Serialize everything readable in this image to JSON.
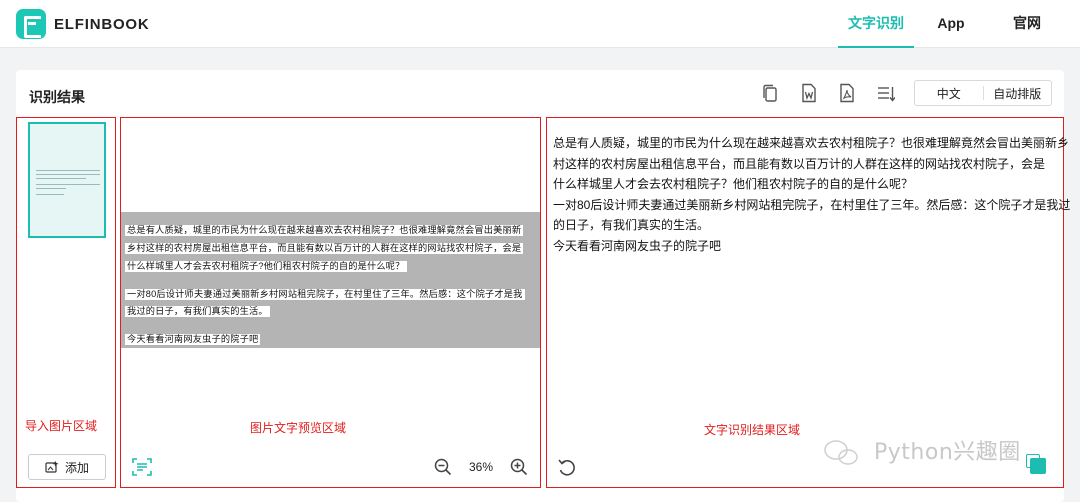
{
  "app": {
    "brand": "ELFINBOOK"
  },
  "nav": {
    "items": [
      "文字识别",
      "App",
      "官网"
    ],
    "active": "文字识别"
  },
  "card": {
    "title": "识别结果"
  },
  "toolbar": {
    "icons": [
      "copy-icon",
      "word-export-icon",
      "pdf-export-icon",
      "sort-lines-icon"
    ],
    "lang": {
      "zh": "中文",
      "auto": "自动排版"
    }
  },
  "captions": {
    "left": "导入图片区域",
    "mid": "图片文字预览区域",
    "right": "文字识别结果区域"
  },
  "left": {
    "add_label": "添加"
  },
  "preview": {
    "lines": [
      "总是有人质疑，城里的市民为什么现在越来越喜欢去农村租院子？也很难理解竟然会冒出美丽新",
      "乡村这样的农村房屋出租信息平台，而且能有数以百万计的人群在这样的网站找农村院子，会是",
      "什么样城里人才会去农村租院子?他们租农村院子的自的是什么呢？",
      "一对80后设计师夫妻通过美丽新乡村网站租完院子，在村里住了三年。然后感：这个院子才是我",
      "我过的日子，有我们真实的生活。",
      "今天看看河南网友虫子的院子吧"
    ],
    "zoom": "36%"
  },
  "result": {
    "lines": [
      "总是有人质疑，城里的市民为什么现在越来越喜欢去农村租院子？也很难理解竟然会冒出美丽新乡",
      "村这样的农村房屋出租信息平台，而且能有数以百万计的人群在这样的网站找农村院子，会是",
      "什么样城里人才会去农村租院子？他们租农村院子的自的是什么呢？",
      "一对80后设计师夫妻通过美丽新乡村网站租完院子，在村里住了三年。然后感：这个院子才是我过",
      "的日子，有我们真实的生活。",
      "今天看看河南网友虫子的院子吧"
    ]
  },
  "watermark": "Python兴趣圈",
  "colors": {
    "accent": "#1cbcb0",
    "annotation": "#e21d1d"
  }
}
